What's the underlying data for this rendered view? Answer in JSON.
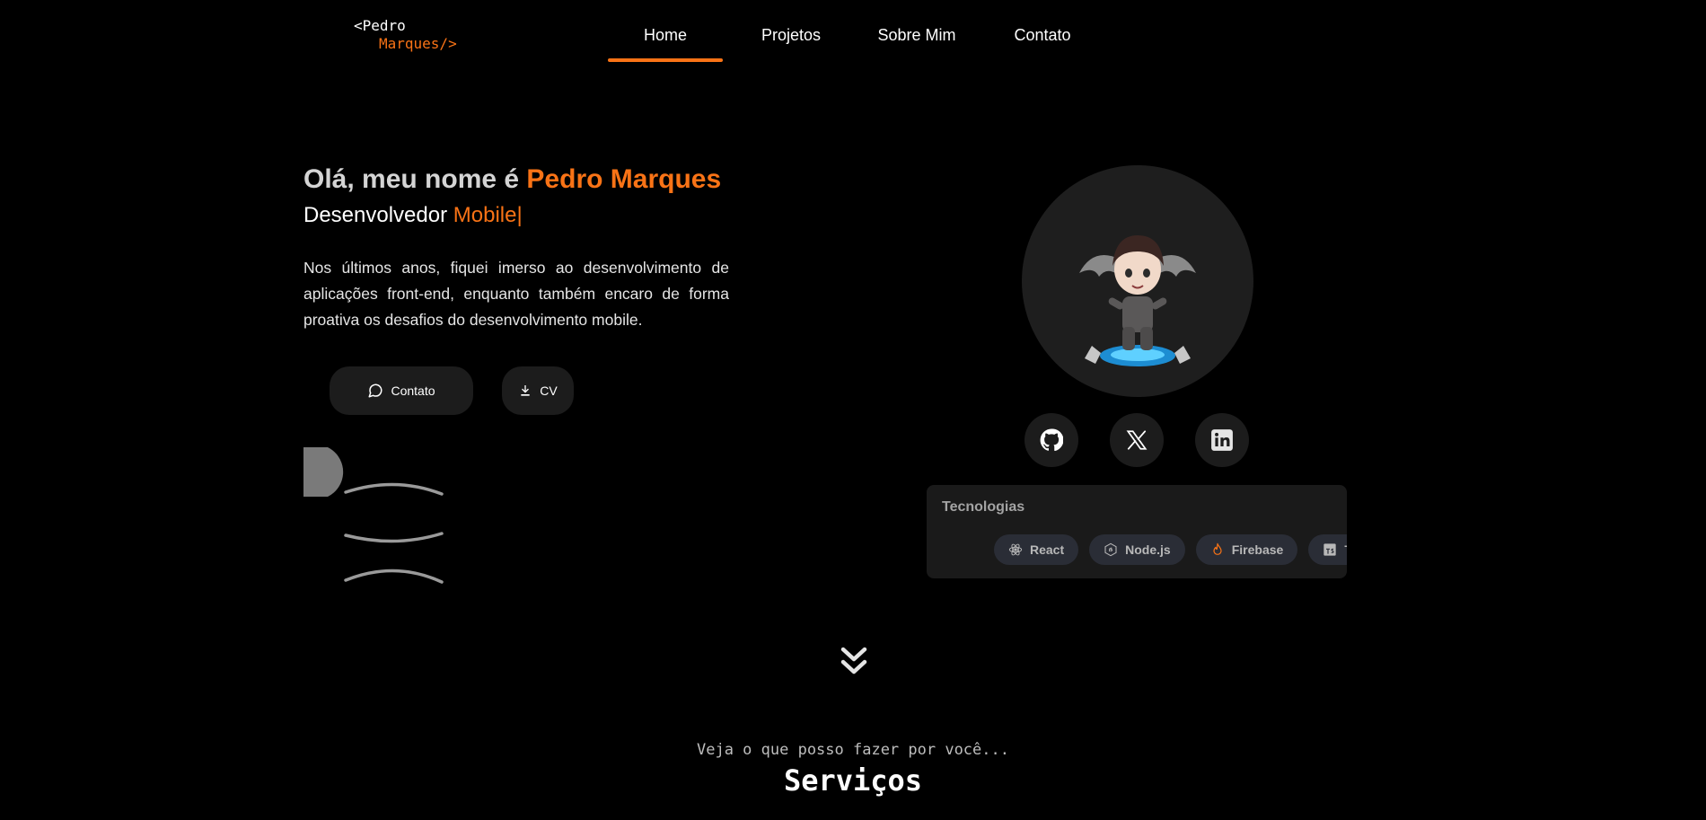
{
  "header": {
    "logo_line1": "<Pedro",
    "logo_line2": "Marques/>",
    "nav": [
      "Home",
      "Projetos",
      "Sobre Mim",
      "Contato"
    ],
    "active_nav": "Home"
  },
  "hero": {
    "greeting": "Olá, meu nome é",
    "name": "Pedro Marques",
    "role_prefix": "Desenvolvedor",
    "role_highlight": "Mobile",
    "role_caret": "|",
    "intro": "Nos últimos anos, fiquei imerso ao desenvolvimento de aplicações front-end, enquanto também encaro de forma proativa os desafios do desenvolvimento mobile.",
    "buttons": {
      "contact_label": "Contato",
      "contact_icon": "chat-bubble-icon",
      "cv_label": "CV",
      "cv_icon": "download-icon"
    }
  },
  "profile": {
    "avatar": "chibi-character-avatar",
    "social": [
      "github-icon",
      "x-twitter-icon",
      "linkedin-icon"
    ]
  },
  "technologies": {
    "title": "Tecnologias",
    "items": [
      {
        "label": "React",
        "icon": "react-icon"
      },
      {
        "label": "Node.js",
        "icon": "nodejs-icon"
      },
      {
        "label": "Firebase",
        "icon": "firebase-icon"
      },
      {
        "label": "Ty",
        "icon": "typescript-icon"
      }
    ]
  },
  "services": {
    "subtitle": "Veja o que posso fazer por você...",
    "title": "Serviços"
  },
  "colors": {
    "accent": "#f97316",
    "background": "#000000",
    "card": "#1a1a1a"
  }
}
